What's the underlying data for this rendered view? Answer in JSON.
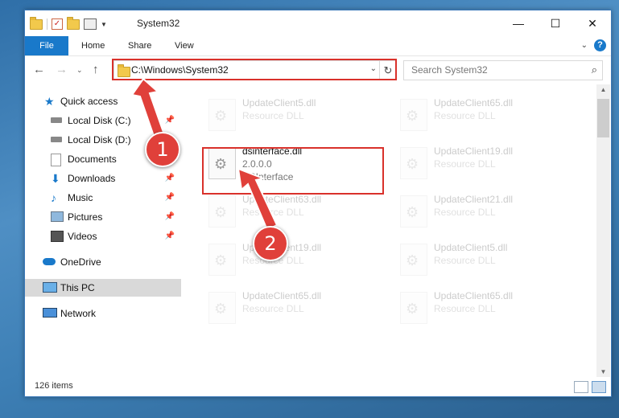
{
  "window": {
    "title": "System32"
  },
  "window_controls": {
    "minimize": "—",
    "maximize": "☐",
    "close": "✕"
  },
  "ribbon": {
    "file": "File",
    "tabs": [
      "Home",
      "Share",
      "View"
    ],
    "help": "?"
  },
  "address_bar": {
    "path": "C:\\Windows\\System32"
  },
  "search": {
    "placeholder": "Search System32"
  },
  "sidebar": {
    "items": [
      {
        "label": "Quick access",
        "icon": "star-icon",
        "pinned": false
      },
      {
        "label": "Local Disk (C:)",
        "icon": "drive-icon",
        "pinned": true
      },
      {
        "label": "Local Disk (D:)",
        "icon": "drive-icon",
        "pinned": true
      },
      {
        "label": "Documents",
        "icon": "documents-icon",
        "pinned": true
      },
      {
        "label": "Downloads",
        "icon": "download-icon",
        "pinned": true
      },
      {
        "label": "Music",
        "icon": "music-icon",
        "pinned": true
      },
      {
        "label": "Pictures",
        "icon": "pictures-icon",
        "pinned": true
      },
      {
        "label": "Videos",
        "icon": "videos-icon",
        "pinned": true
      },
      {
        "label": "OneDrive",
        "icon": "cloud-icon",
        "pinned": false
      },
      {
        "label": "This PC",
        "icon": "computer-icon",
        "pinned": false,
        "selected": true
      },
      {
        "label": "Network",
        "icon": "network-icon",
        "pinned": false
      }
    ]
  },
  "files": [
    {
      "name": "UpdateClient5.dll",
      "type": "Resource DLL"
    },
    {
      "name": "UpdateClient65.dll",
      "type": "Resource DLL"
    },
    {
      "name": "dsinterface.dll",
      "version": "2.0.0.0",
      "description": "DSInterface",
      "highlighted": true
    },
    {
      "name": "UpdateClient19.dll",
      "type": "Resource DLL"
    },
    {
      "name": "UpdateClient63.dll",
      "type": "Resource DLL"
    },
    {
      "name": "UpdateClient21.dll",
      "type": "Resource DLL"
    },
    {
      "name": "UpdateClient19.dll",
      "type": "Resource DLL"
    },
    {
      "name": "UpdateClient5.dll",
      "type": "Resource DLL"
    },
    {
      "name": "UpdateClient65.dll",
      "type": "Resource DLL"
    },
    {
      "name": "UpdateClient65.dll",
      "type": "Resource DLL"
    }
  ],
  "status_bar": {
    "item_count": "126 items"
  },
  "callouts": [
    "1",
    "2"
  ],
  "colors": {
    "accent": "#1979ca",
    "highlight_red": "#d9312b",
    "callout": "#e0403a"
  }
}
